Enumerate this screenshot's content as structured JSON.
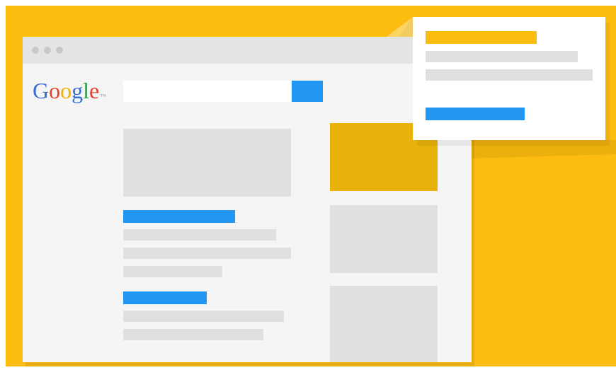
{
  "logo": {
    "letters": [
      {
        "char": "G",
        "color": "#3b6fd6"
      },
      {
        "char": "o",
        "color": "#e2432a"
      },
      {
        "char": "o",
        "color": "#f0b400"
      },
      {
        "char": "g",
        "color": "#3b6fd6"
      },
      {
        "char": "l",
        "color": "#2e9e48"
      },
      {
        "char": "e",
        "color": "#e2432a"
      }
    ],
    "trademark": "TM"
  },
  "colors": {
    "background": "#fdbd10",
    "accent_blue": "#2196f3",
    "ad_highlight": "#e8b20b",
    "placeholder_gray": "#e0e0e0",
    "window": "#f5f5f5"
  },
  "icons": [
    "window-control-dot",
    "search-button"
  ]
}
